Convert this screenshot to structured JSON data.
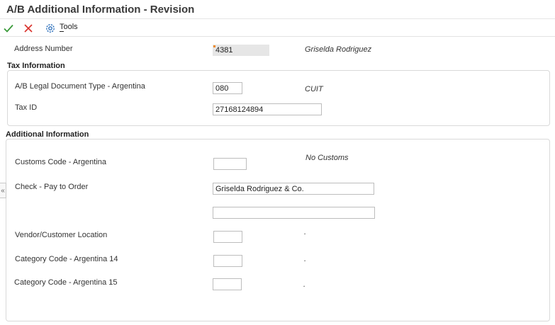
{
  "window": {
    "title": "A/B Additional Information - Revision"
  },
  "toolbar": {
    "ok_icon": "checkmark-icon",
    "cancel_icon": "close-icon",
    "tools_icon": "gear-icon",
    "tools_label": "Tools"
  },
  "header": {
    "address_number_label": "Address Number",
    "address_number_value": "4381",
    "address_name": "Griselda Rodriguez"
  },
  "tax": {
    "section_title": "Tax Information",
    "doc_type_label": "A/B Legal Document Type - Argentina",
    "doc_type_value": "080",
    "doc_type_desc": "CUIT",
    "tax_id_label": "Tax ID",
    "tax_id_value": "27168124894"
  },
  "additional": {
    "section_title": "Additional Information",
    "customs_label": "Customs Code - Argentina",
    "customs_value": "",
    "customs_desc": "No Customs",
    "pay_to_label": "Check - Pay to Order",
    "pay_to_value_1": "Griselda Rodriguez & Co.",
    "pay_to_value_2": "",
    "location_label": "Vendor/Customer Location",
    "location_value": "",
    "location_desc": ".",
    "cat14_label": "Category Code - Argentina 14",
    "cat14_value": "",
    "cat14_desc": ".",
    "cat15_label": "Category Code - Argentina 15",
    "cat15_value": "",
    "cat15_desc": "."
  },
  "colors": {
    "ok": "#3a9a3a",
    "cancel": "#d9312b",
    "tools": "#2a6ebb",
    "flag": "#f08a24"
  }
}
